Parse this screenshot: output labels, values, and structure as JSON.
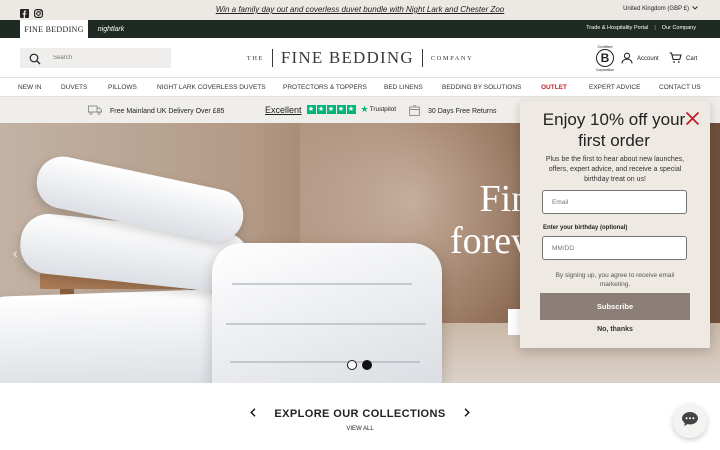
{
  "announcement": {
    "promo": "Win a family day out and coverless duvet bundle with Night Lark and Chester Zoo",
    "locale": "United Kingdom (GBP £)"
  },
  "brandbar": {
    "tabs": [
      "FINE BEDDING",
      "nightlark"
    ],
    "links": [
      "Trade & Hospitality Portal",
      "Our Company"
    ]
  },
  "header": {
    "search_placeholder": "Search",
    "logo_the": "THE",
    "logo_name": "FINE BEDDING",
    "logo_company": "COMPANY",
    "bcorp_top": "Certified",
    "bcorp_letter": "B",
    "bcorp_bottom": "Corporation",
    "account_label": "Account",
    "cart_label": "Cart"
  },
  "nav": {
    "items": [
      "NEW IN",
      "DUVETS",
      "PILLOWS",
      "NIGHT LARK COVERLESS DUVETS",
      "PROTECTORS & TOPPERS",
      "BED LINENS",
      "BEDDING BY SOLUTIONS",
      "OUTLET",
      "EXPERT ADVICE",
      "CONTACT US"
    ],
    "highlight_color": "#c0202a"
  },
  "usp": {
    "delivery": "Free Mainland UK Delivery Over £85",
    "rating_word": "Excellent",
    "trustpilot": "Trustpilot",
    "returns": "30 Days Free Returns"
  },
  "hero": {
    "headline_line1": "Fin",
    "headline_line2": "forev"
  },
  "popup": {
    "title": "Enjoy 10% off your first order",
    "text": "Plus be the first to hear about new launches, offers, expert advice, and receive a special birthday treat on us!",
    "email_placeholder": "Email",
    "birthday_label": "Enter your birthday (optional)",
    "birthday_placeholder": "MM/DD",
    "consent": "By signing up, you agree to receive email marketing.",
    "subscribe_label": "Subscribe",
    "no_thanks_label": "No, thanks",
    "accent_color": "#8a7e76",
    "close_color": "#c0202a"
  },
  "collections": {
    "title": "EXPLORE OUR COLLECTIONS",
    "view_all": "VIEW ALL"
  },
  "icons": {
    "social": [
      "facebook-icon",
      "instagram-icon"
    ],
    "search": "search-icon",
    "account": "user-icon",
    "cart": "cart-icon",
    "chat": "chat-icon"
  }
}
